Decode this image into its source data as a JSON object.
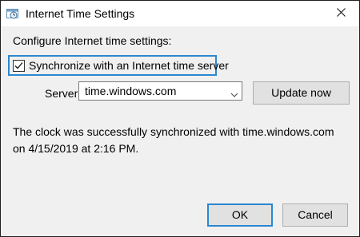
{
  "window": {
    "title": "Internet Time Settings",
    "title_icon": "clock-window-icon",
    "close_icon": "close-icon"
  },
  "main": {
    "intro": "Configure Internet time settings:",
    "sync_checkbox": {
      "label": "Synchronize with an Internet time server",
      "checked": true
    },
    "server_label": "Server:",
    "server_value": "time.windows.com",
    "update_button": "Update now",
    "status_text": "The clock was successfully synchronized with time.windows.com on 4/15/2019 at 2:16 PM."
  },
  "footer": {
    "ok_label": "OK",
    "cancel_label": "Cancel"
  },
  "colors": {
    "focus_accent": "#2b87d1",
    "dialog_background": "#f0f0f0",
    "button_face": "#e1e1e1"
  }
}
